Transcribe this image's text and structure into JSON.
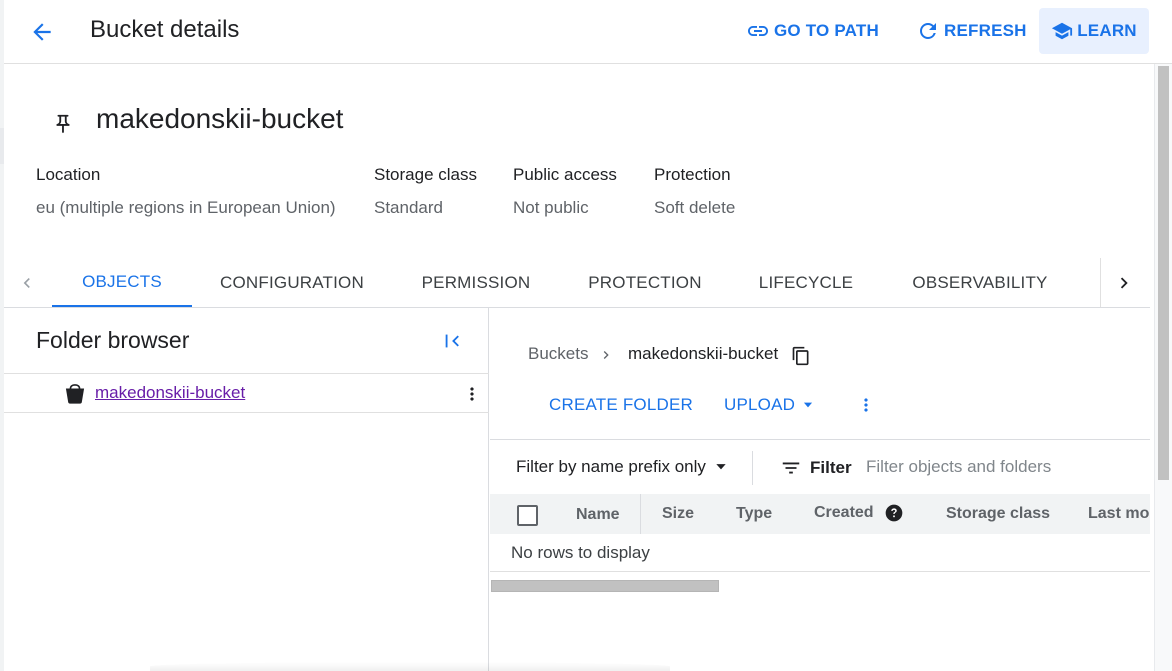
{
  "header": {
    "title": "Bucket details",
    "go_to_path": "GO TO PATH",
    "refresh": "REFRESH",
    "learn": "LEARN"
  },
  "bucket": {
    "name": "makedonskii-bucket"
  },
  "properties": [
    {
      "label": "Location",
      "value": "eu (multiple regions in European Union)"
    },
    {
      "label": "Storage class",
      "value": "Standard"
    },
    {
      "label": "Public access",
      "value": "Not public"
    },
    {
      "label": "Protection",
      "value": "Soft delete"
    }
  ],
  "tabs": [
    {
      "label": "OBJECTS",
      "active": true
    },
    {
      "label": "CONFIGURATION"
    },
    {
      "label": "PERMISSION"
    },
    {
      "label": "PROTECTION"
    },
    {
      "label": "LIFECYCLE"
    },
    {
      "label": "OBSERVABILITY"
    }
  ],
  "folder_browser": {
    "title": "Folder browser",
    "items": [
      {
        "label": "makedonskii-bucket"
      }
    ]
  },
  "breadcrumb": {
    "root": "Buckets",
    "current": "makedonskii-bucket"
  },
  "actions": {
    "create_folder": "CREATE FOLDER",
    "upload": "UPLOAD"
  },
  "filter": {
    "prefix_select": "Filter by name prefix only",
    "label": "Filter",
    "placeholder": "Filter objects and folders"
  },
  "table": {
    "columns": [
      "Name",
      "Size",
      "Type",
      "Created",
      "Storage class",
      "Last mo"
    ],
    "empty_message": "No rows to display"
  },
  "colors": {
    "accent": "#1a73e8",
    "visited_link": "#681da8",
    "learn_bg": "#e8f0fe"
  },
  "icons": [
    "back-arrow-icon",
    "link-icon",
    "refresh-icon",
    "school-icon",
    "pin-icon",
    "chevron-left-icon",
    "chevron-right-icon",
    "collapse-panel-icon",
    "bucket-icon",
    "more-vert-icon",
    "copy-icon",
    "dropdown-arrow-icon",
    "filter-list-icon",
    "help-icon"
  ]
}
